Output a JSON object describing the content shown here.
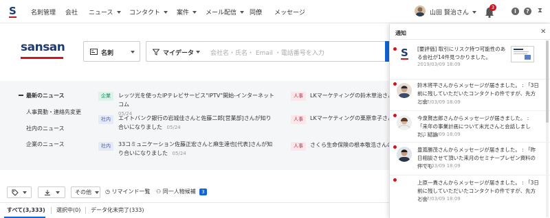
{
  "header": {
    "nav": [
      "名刺管理",
      "会社",
      "ニュース",
      "コンタクト",
      "案件",
      "メール配信",
      "同僚",
      "メッセージ"
    ],
    "user_name": "山田 賢治さん",
    "notification_count": "3"
  },
  "brand": {
    "name": "sansan"
  },
  "search": {
    "type_label": "名刺",
    "scope_label": "マイデータ",
    "placeholder": "会社名・氏名・ Email ・電話番号を入力"
  },
  "news": {
    "categories": [
      "最新のニュース",
      "人事異動・連絡先変更",
      "社内のニュース",
      "企業のニュース"
    ],
    "items": [
      {
        "tag": "企業",
        "text": "レッツ光を使ったIPテレビサービス\"IPTV\"開始-インターネットコム",
        "date": "05/24"
      },
      {
        "tag": "人事",
        "text": "LKマーケティングの鈴木草治さんの役",
        "date": ""
      },
      {
        "tag": "社内",
        "text": "エイトバンク銀行の岩城佳さんと佐藤二郎[営業部]さんが知り合いになりました",
        "date": "05/24"
      },
      {
        "tag": "人事",
        "text": "LKマーケティングの栗原幸子さんの",
        "date": ""
      },
      {
        "tag": "社内",
        "text": "33コミュニケーション佐藤正宏さんと麻生達也[代表]さんが知り合いになりました",
        "date": "05/24"
      },
      {
        "tag": "人事",
        "text": "さくら生命保険の根本敬浩さんの役",
        "date": ""
      }
    ]
  },
  "toolbar": {
    "other_label": "その他",
    "reminder_label": "リマインド一覧",
    "same_person_label": "同一人物候補",
    "same_person_count": "3"
  },
  "tabs": [
    "すべて(3,333)",
    "選択中(0)",
    "データ化未完了(333)"
  ],
  "notifications": {
    "title": "通知",
    "items": [
      {
        "text": "[要評価] 取引にリスク持つ可能性のある会社が14件見つかりました。",
        "time": "2019/03/09 18:09"
      },
      {
        "text": "鈴木将平さんからメッセージが届きました。 : 「3日前に残していただいたコンタクトの件ですが、先方と会",
        "time": "2017/03/09 18:09"
      },
      {
        "text": "今泉賢志郎さんからメッセージが届きました。 : 「来年の事業計画について末光さんと会話しました。結論",
        "time": "2017/03/09 18:09"
      },
      {
        "text": "豊嶌勝茂さんからメッセージが届きました。 : 「昨日相談させて頂いた来月のセミナープレゼン資料の件でも",
        "time": "2017/03/09 18:09"
      },
      {
        "text": "上原一貴さんからメッセージが届きました。 : 「3日前に残していただいたコンタクトの件ですが、先方と会",
        "time": "2017/03/09 18:09"
      }
    ]
  },
  "colors": {
    "accent": "#1064d4",
    "brand_red": "#d4121d",
    "brand_navy": "#1f3a6e"
  }
}
